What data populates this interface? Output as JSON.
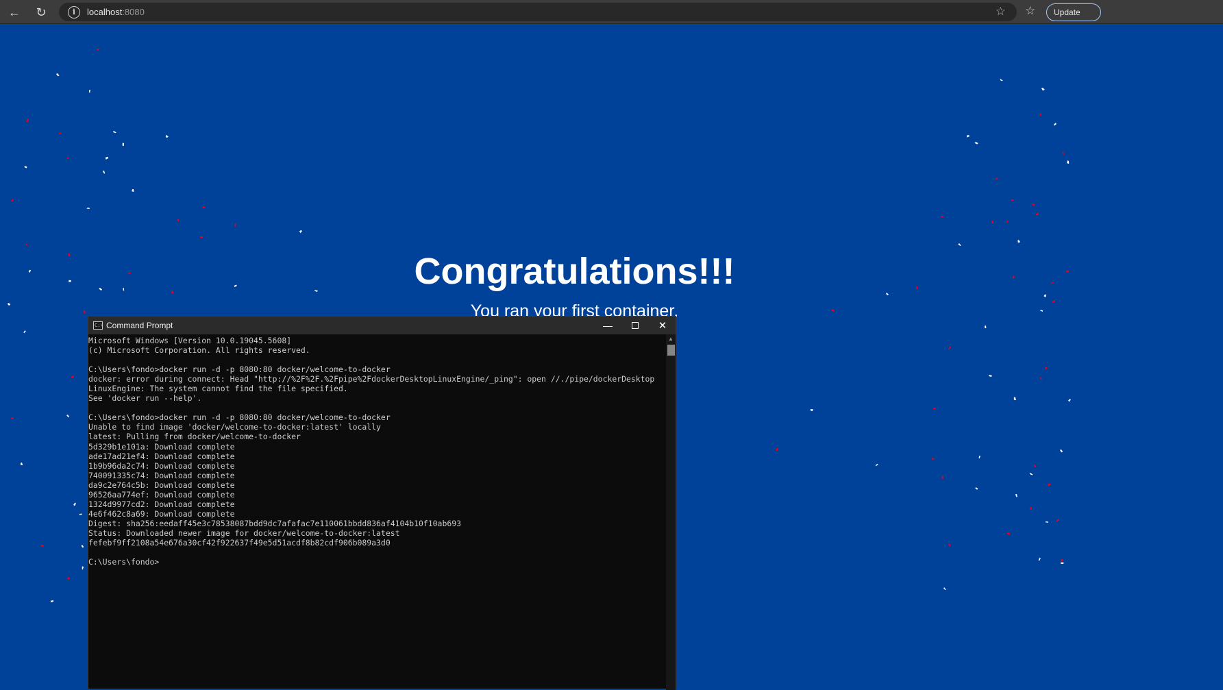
{
  "browser": {
    "url_host": "localhost",
    "url_port": ":8080",
    "update_label": "Update",
    "icons": [
      "back-arrow-icon",
      "reload-icon",
      "site-info-icon",
      "bookmark-star-icon",
      "extensions-icon"
    ]
  },
  "page": {
    "heading": "Congratulations!!!",
    "subheading": "You ran your first container.",
    "colors": {
      "background": "#00419a",
      "confetti_red": "#e8001c",
      "confetti_white": "#ffffff"
    }
  },
  "cmd": {
    "title": "Command Prompt",
    "output_lines": [
      "Microsoft Windows [Version 10.0.19045.5608]",
      "(c) Microsoft Corporation. All rights reserved.",
      "",
      "C:\\Users\\fondo>docker run -d -p 8080:80 docker/welcome-to-docker",
      "docker: error during connect: Head \"http://%2F%2F.%2Fpipe%2FdockerDesktopLinuxEngine/_ping\": open //./pipe/dockerDesktop",
      "LinuxEngine: The system cannot find the file specified.",
      "See 'docker run --help'.",
      "",
      "C:\\Users\\fondo>docker run -d -p 8080:80 docker/welcome-to-docker",
      "Unable to find image 'docker/welcome-to-docker:latest' locally",
      "latest: Pulling from docker/welcome-to-docker",
      "5d329b1e101a: Download complete",
      "ade17ad21ef4: Download complete",
      "1b9b96da2c74: Download complete",
      "740091335c74: Download complete",
      "da9c2e764c5b: Download complete",
      "96526aa774ef: Download complete",
      "1324d9977cd2: Download complete",
      "4e6f462c8a69: Download complete",
      "Digest: sha256:eedaff45e3c78538087bdd9dc7afafac7e110061bbdd836af4104b10f10ab693",
      "Status: Downloaded newer image for docker/welcome-to-docker:latest",
      "fefebf9ff2108a54e676a30cf42f922637f49e5d51acdf8b82cdf906b089a3d0",
      "",
      "C:\\Users\\fondo>"
    ]
  }
}
